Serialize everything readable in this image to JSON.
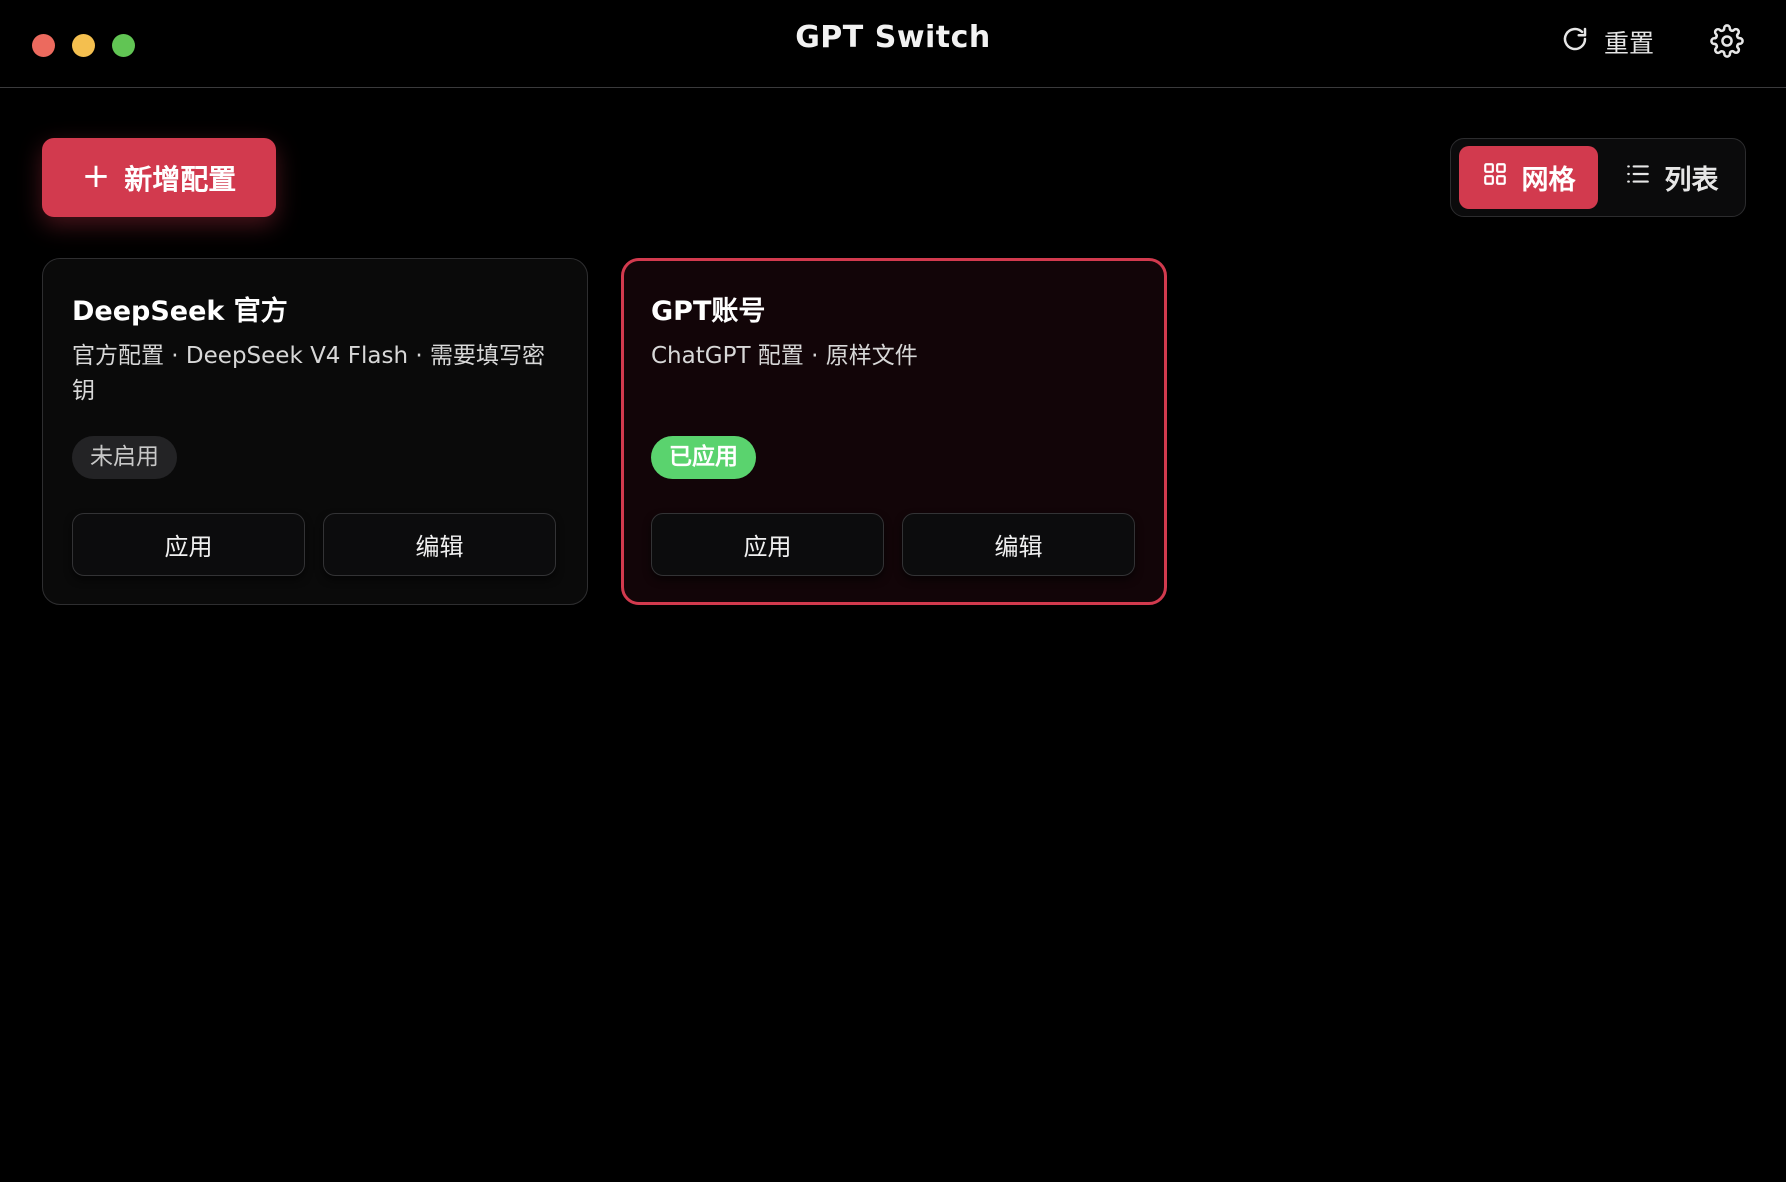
{
  "window": {
    "title": "GPT Switch",
    "traffic_lights": [
      "close",
      "minimize",
      "maximize"
    ]
  },
  "header": {
    "reset_label": "重置",
    "reset_icon": "refresh-icon",
    "settings_icon": "gear-icon"
  },
  "toolbar": {
    "add_label": "新增配置",
    "add_icon": "plus-icon",
    "view_toggle": {
      "grid_label": "网格",
      "list_label": "列表",
      "selected": "网格"
    }
  },
  "colors": {
    "accent": "#d23a4e",
    "success": "#5ad36e",
    "background": "#000000"
  },
  "cards": [
    {
      "title": "DeepSeek 官方",
      "description": "官方配置 · DeepSeek V4 Flash · 需要填写密钥",
      "status": "未启用",
      "apply_label": "应用",
      "edit_label": "编辑",
      "active": false
    },
    {
      "title": "GPT账号",
      "description": "ChatGPT 配置 · 原样文件",
      "status": "已应用",
      "apply_label": "应用",
      "edit_label": "编辑",
      "active": true
    }
  ]
}
